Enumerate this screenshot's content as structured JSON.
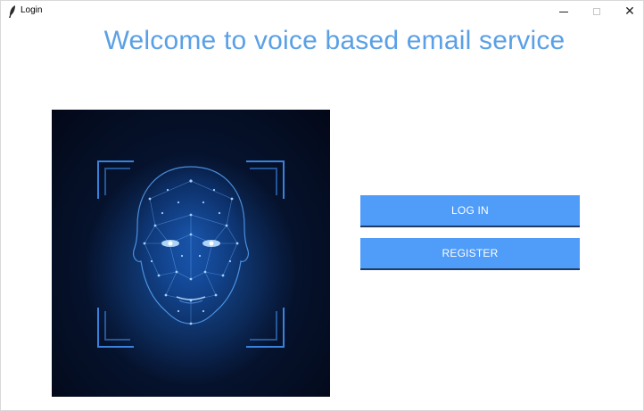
{
  "window": {
    "title": "Login",
    "controls": {
      "minimize_icon": "minimize-icon",
      "maximize_icon": "maximize-icon",
      "close_icon": "close-icon"
    }
  },
  "main": {
    "heading": "Welcome to voice based email service",
    "image": {
      "icon": "face-scan-illustration"
    },
    "buttons": {
      "login": "LOG IN",
      "register": "REGISTER"
    }
  },
  "colors": {
    "heading": "#5aa0e6",
    "button_bg": "#4f9cf9",
    "button_text": "#ffffff",
    "image_bg": "#061430",
    "face_glow": "#3b8cff"
  }
}
